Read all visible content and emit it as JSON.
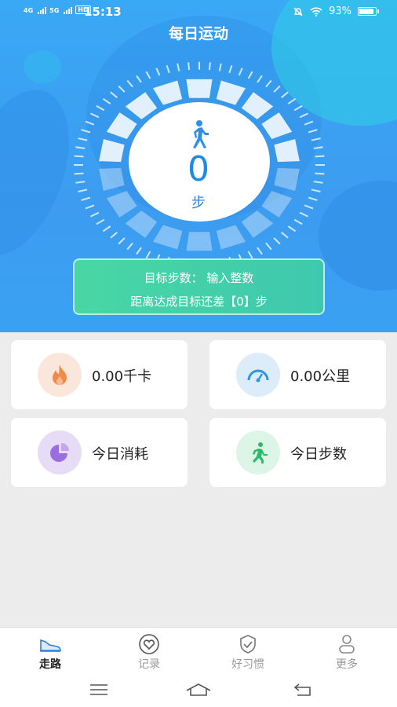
{
  "status": {
    "net1": "4G",
    "net2": "5G",
    "hd": "HD",
    "time": "15:13",
    "battery": "93%"
  },
  "header": {
    "title": "每日运动"
  },
  "tracker": {
    "steps": "0",
    "unit": "步"
  },
  "goal": {
    "line1": "目标步数：  输入整数",
    "line2": "距离达成目标还差【0】步"
  },
  "cards": [
    {
      "label": "0.00千卡",
      "icon": "flame-icon",
      "bg": "#fbe6dc",
      "color": "#f08a4b"
    },
    {
      "label": "0.00公里",
      "icon": "speedometer-icon",
      "bg": "#dcecf9",
      "color": "#2d97e3"
    },
    {
      "label": "今日消耗",
      "icon": "pie-chart-icon",
      "bg": "#e7dcf6",
      "color": "#9a6ee0"
    },
    {
      "label": "今日步数",
      "icon": "runner-icon",
      "bg": "#dcf5e6",
      "color": "#2dbb68"
    }
  ],
  "tabs": [
    {
      "label": "走路",
      "icon": "shoe-icon",
      "active": true
    },
    {
      "label": "记录",
      "icon": "heart-icon",
      "active": false
    },
    {
      "label": "好习惯",
      "icon": "check-badge-icon",
      "active": false
    },
    {
      "label": "更多",
      "icon": "person-icon",
      "active": false
    }
  ],
  "system_nav": [
    {
      "icon": "menu-icon"
    },
    {
      "icon": "home-icon"
    },
    {
      "icon": "back-icon"
    }
  ]
}
